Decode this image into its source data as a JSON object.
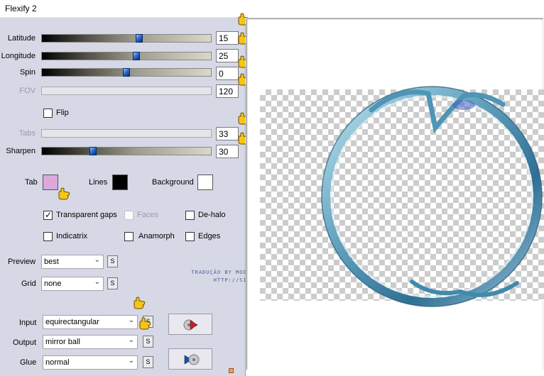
{
  "window": {
    "title": "Flexify 2"
  },
  "sliders": [
    {
      "label": "Latitude",
      "value": "15",
      "fraction": 0.57,
      "disabled": false
    },
    {
      "label": "Longitude",
      "value": "25",
      "fraction": 0.55,
      "disabled": false
    },
    {
      "label": "Spin",
      "value": "0",
      "fraction": 0.5,
      "disabled": false
    },
    {
      "label": "FOV",
      "value": "120",
      "fraction": null,
      "disabled": true
    },
    {
      "label": "Tabs",
      "value": "33",
      "fraction": null,
      "disabled": true
    },
    {
      "label": "Sharpen",
      "value": "30",
      "fraction": 0.3,
      "disabled": false
    }
  ],
  "flip": {
    "label": "Flip",
    "checked": false
  },
  "colors": {
    "tab": {
      "label": "Tab",
      "color": "#dca8dc"
    },
    "lines": {
      "label": "Lines",
      "color": "#000000"
    },
    "background": {
      "label": "Background",
      "color": "#ffffff"
    }
  },
  "options": {
    "transparent_gaps": {
      "label": "Transparent gaps",
      "checked": true
    },
    "faces": {
      "label": "Faces",
      "checked": false,
      "disabled": true
    },
    "de_halo": {
      "label": "De-halo",
      "checked": false
    },
    "indicatrix": {
      "label": "Indicatrix",
      "checked": false
    },
    "anamorph": {
      "label": "Anamorph",
      "checked": false
    },
    "edges": {
      "label": "Edges",
      "checked": false
    }
  },
  "preview": {
    "label": "Preview",
    "value": "best"
  },
  "grid": {
    "label": "Grid",
    "value": "none"
  },
  "input": {
    "label": "Input",
    "value": "equirectangular"
  },
  "output": {
    "label": "Output",
    "value": "mirror ball"
  },
  "glue": {
    "label": "Glue",
    "value": "normal"
  },
  "s_button_label": "S",
  "watermark": {
    "line1": "TRADUÇÃO BY MODERAÇÃO SIM PSP",
    "line2": "HTTP://SIMPSP.COM"
  },
  "icons": {
    "hand": "pointing-hand-icon",
    "play_forward": "play-forward-icon",
    "play_back": "play-back-icon",
    "chevron": "chevron-down-icon"
  }
}
